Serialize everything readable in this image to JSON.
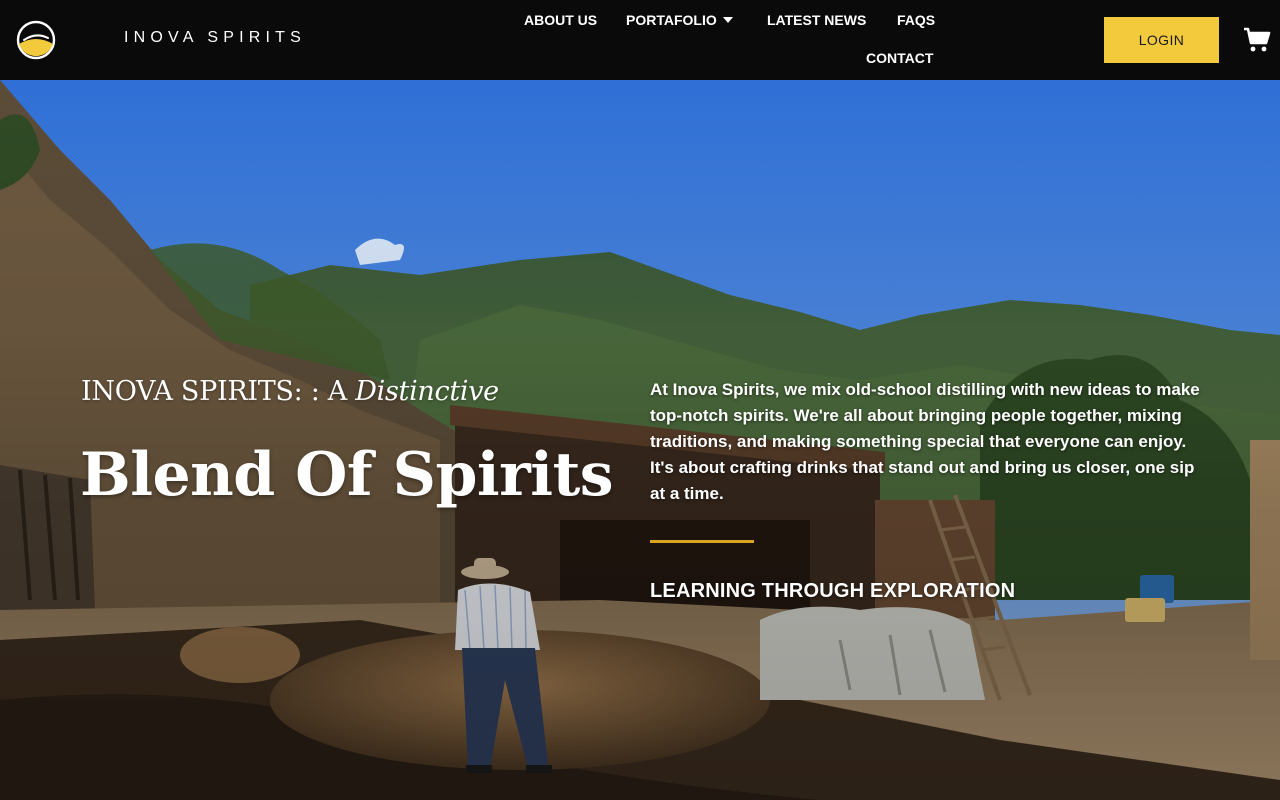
{
  "header": {
    "brand": "INOVA SPIRITS",
    "nav": {
      "about": "ABOUT US",
      "portfolio": "PORTAFOLIO",
      "news": "LATEST NEWS",
      "faqs": "FAQS",
      "contact": "CONTACT"
    },
    "login_label": "LOGIN",
    "icons": {
      "logo": "logo-icon",
      "dropdown": "caret-down-icon",
      "cart": "shopping-cart-icon"
    }
  },
  "hero": {
    "kicker_lead": "INOVA SPIRITS: : A ",
    "kicker_emph": "Distinctive",
    "headline": "Blend Of Spirits",
    "blurb": "At Inova Spirits, we mix old-school distilling with new ideas to make top-notch spirits. We're all about bringing people together, mixing traditions, and making something special that everyone can enjoy. It's about crafting drinks that stand out and bring us closer, one sip at a time.",
    "subheading": "LEARNING THROUGH EXPLORATION"
  },
  "colors": {
    "header_bg": "#0a0a0a",
    "accent": "#f3ca3c",
    "rule": "#d9a421",
    "sky": "#4a82d8"
  }
}
